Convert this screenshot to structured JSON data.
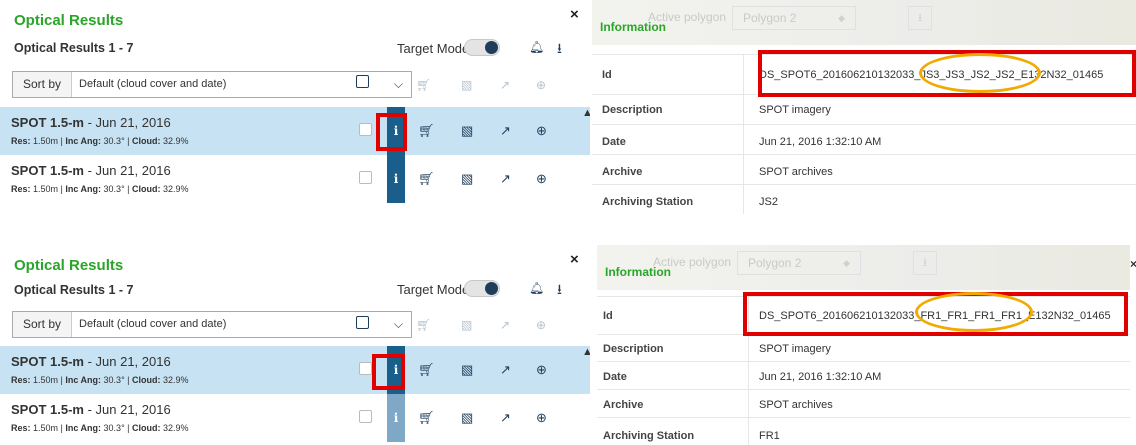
{
  "panels": [
    {
      "results": {
        "title": "Optical Results",
        "close": "×",
        "count": "Optical Results 1 - 7",
        "target_mode": "Target Mode",
        "sort_label": "Sort by",
        "sort_value": "Default (cloud cover and date)",
        "rows": [
          {
            "sensor": "SPOT 1.5-m",
            "date": " - Jun 21, 2016",
            "res_label": "Res:",
            "res": " 1.50m | ",
            "inc_label": "Inc Ang:",
            "inc": " 30.3° | ",
            "cloud_label": "Cloud:",
            "cloud": " 32.9%",
            "info": "i"
          },
          {
            "sensor": "SPOT 1.5-m",
            "date": " - Jun 21, 2016",
            "res_label": "Res:",
            "res": " 1.50m | ",
            "inc_label": "Inc Ang:",
            "inc": " 30.3° | ",
            "cloud_label": "Cloud:",
            "cloud": " 32.9%",
            "info": "i"
          }
        ]
      },
      "info": {
        "heading": "Information",
        "active_polygon": "Active polygon",
        "polygon": "Polygon 2",
        "rows": [
          {
            "key": "Id",
            "value": "DS_SPOT6_201606210132033_JS3_JS3_JS2_JS2_E132N32_01465"
          },
          {
            "key": "Description",
            "value": "SPOT imagery"
          },
          {
            "key": "Date",
            "value": "Jun 21, 2016 1:32:10 AM"
          },
          {
            "key": "Archive",
            "value": "SPOT archives"
          },
          {
            "key": "Archiving Station",
            "value": "JS2"
          }
        ]
      }
    },
    {
      "results": {
        "title": "Optical Results",
        "close": "×",
        "count": "Optical Results 1 - 7",
        "target_mode": "Target Mode",
        "sort_label": "Sort by",
        "sort_value": "Default (cloud cover and date)",
        "rows": [
          {
            "sensor": "SPOT 1.5-m",
            "date": " - Jun 21, 2016",
            "res_label": "Res:",
            "res": " 1.50m | ",
            "inc_label": "Inc Ang:",
            "inc": " 30.3° | ",
            "cloud_label": "Cloud:",
            "cloud": " 32.9%",
            "info": "i"
          },
          {
            "sensor": "SPOT 1.5-m",
            "date": " - Jun 21, 2016",
            "res_label": "Res:",
            "res": " 1.50m | ",
            "inc_label": "Inc Ang:",
            "inc": " 30.3° | ",
            "cloud_label": "Cloud:",
            "cloud": " 32.9%",
            "info": "i"
          }
        ]
      },
      "info": {
        "heading": "Information",
        "active_polygon": "Active polygon",
        "polygon": "Polygon 2",
        "rows": [
          {
            "key": "Id",
            "value": "DS_SPOT6_201606210132033_FR1_FR1_FR1_FR1_E132N32_01465"
          },
          {
            "key": "Description",
            "value": "SPOT imagery"
          },
          {
            "key": "Date",
            "value": "Jun 21, 2016 1:32:10 AM"
          },
          {
            "key": "Archive",
            "value": "SPOT archives"
          },
          {
            "key": "Archiving Station",
            "value": "FR1"
          }
        ]
      }
    }
  ],
  "colors": {
    "title_green": "#2aa52a",
    "selected_row": "#c6e2f3",
    "info_strip": "#1a5e8c",
    "icon_navy": "#1f3d5a",
    "highlight_red": "#e00000",
    "highlight_orange": "#f2a900"
  },
  "icons": [
    "bell-icon",
    "export-icon",
    "cart-icon",
    "image-icon",
    "pin-icon",
    "target-icon",
    "chevron-down-icon",
    "chevron-up-icon",
    "close-icon",
    "info-icon"
  ]
}
